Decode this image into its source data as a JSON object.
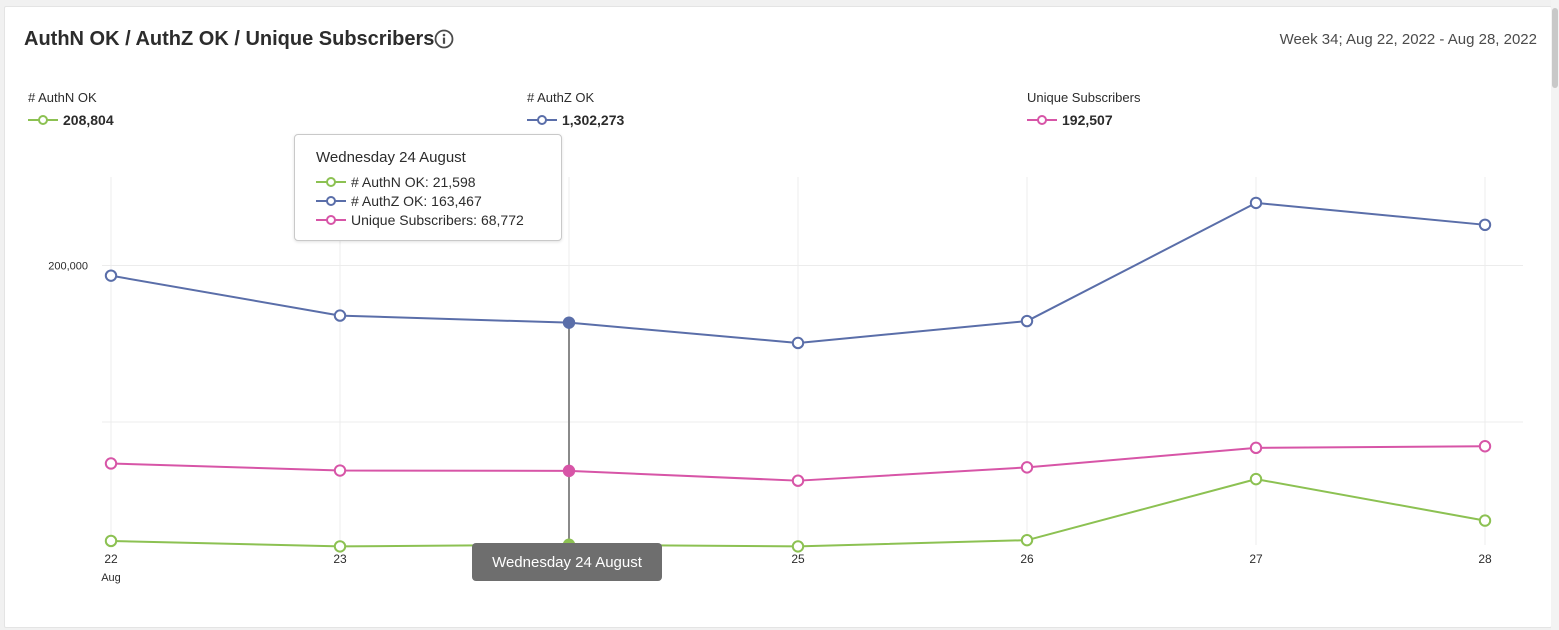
{
  "header": {
    "title": "AuthN OK / AuthZ OK / Unique Subscribers",
    "date_range": "Week 34; Aug 22, 2022 - Aug 28, 2022"
  },
  "legend": [
    {
      "label": "# AuthN OK",
      "total": "208,804",
      "color": "#8cc152"
    },
    {
      "label": "# AuthZ OK",
      "total": "1,302,273",
      "color": "#5a6ea9"
    },
    {
      "label": "Unique Subscribers",
      "total": "192,507",
      "color": "#d755a7"
    }
  ],
  "tooltip": {
    "title": "Wednesday 24 August",
    "rows": [
      "# AuthN OK: 21,598",
      "# AuthZ OK: 163,467",
      "Unique Subscribers: 68,772"
    ]
  },
  "x_badge": "Wednesday 24 August",
  "chart_data": {
    "type": "line",
    "categories": [
      "22",
      "23",
      "24",
      "25",
      "26",
      "27",
      "28"
    ],
    "x_sublabels": [
      "Aug",
      "",
      "",
      "",
      "",
      "",
      ""
    ],
    "y_ticks": [
      {
        "value": 200000,
        "label": "200,000"
      },
      {
        "value": 100000,
        "label": ""
      }
    ],
    "ylim": [
      0,
      250000
    ],
    "series": [
      {
        "name": "# AuthN OK",
        "color": "#8cc152",
        "values": [
          24000,
          20500,
          21598,
          20500,
          24500,
          63500,
          37000
        ]
      },
      {
        "name": "# AuthZ OK",
        "color": "#5a6ea9",
        "values": [
          193500,
          168000,
          163467,
          150500,
          164500,
          240000,
          226000
        ]
      },
      {
        "name": "Unique Subscribers",
        "color": "#d755a7",
        "values": [
          73500,
          69000,
          68772,
          62500,
          71000,
          83500,
          84500
        ]
      }
    ],
    "highlight_index": 2
  }
}
